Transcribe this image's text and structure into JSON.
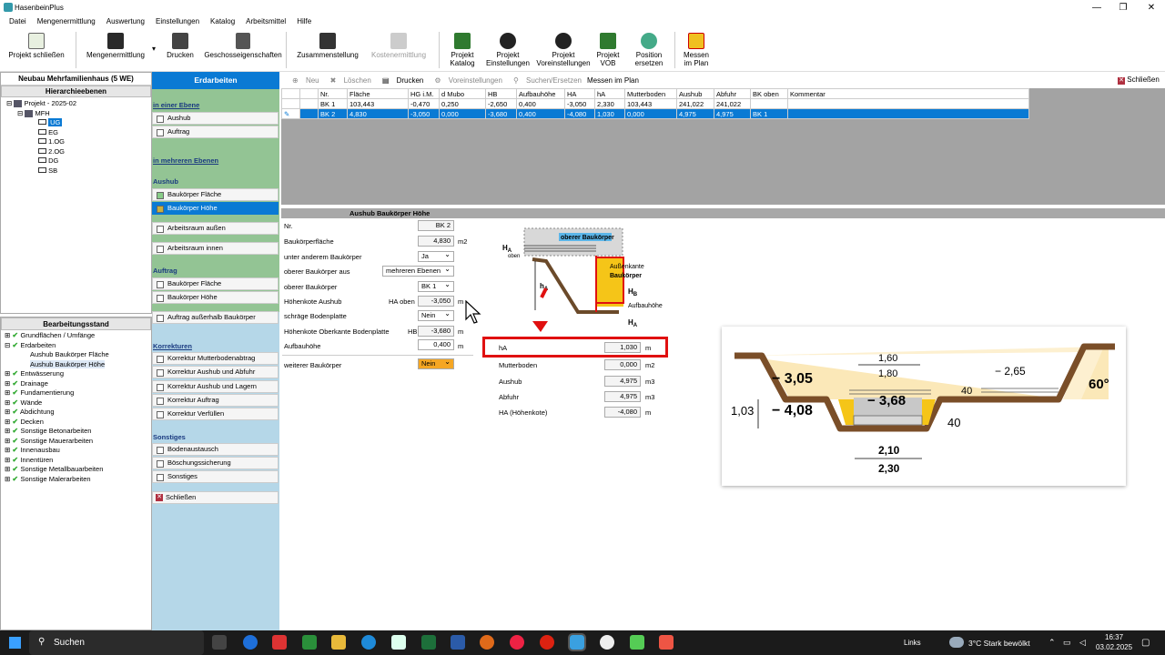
{
  "window": {
    "title": "HasenbeinPlus"
  },
  "menu": [
    "Datei",
    "Mengenermittlung",
    "Auswertung",
    "Einstellungen",
    "Katalog",
    "Arbeitsmittel",
    "Hilfe"
  ],
  "toolbar": {
    "projekt_schliessen": "Projekt schließen",
    "mengenermittlung": "Mengenermittlung",
    "drucken": "Drucken",
    "geschosseigenschaften": "Geschosseigenschaften",
    "zusammenstellung": "Zusammenstellung",
    "kostenermittlung": "Kostenermittlung",
    "projekt_katalog_1": "Projekt",
    "projekt_katalog_2": "Katalog",
    "projekt_einst_1": "Projekt",
    "projekt_einst_2": "Einstellungen",
    "projekt_vor_1": "Projekt",
    "projekt_vor_2": "Voreinstellungen",
    "projekt_vob_1": "Projekt",
    "projekt_vob_2": "VOB",
    "position_1": "Position",
    "position_2": "ersetzen",
    "messen_1": "Messen",
    "messen_2": "im Plan"
  },
  "left": {
    "project_title": "Neubau Mehrfamilienhaus (5 WE)",
    "hierarchy_header": "Hierarchieebenen",
    "tree": [
      {
        "label": "Projekt - 2025-02",
        "level": 0
      },
      {
        "label": "MFH",
        "level": 1
      },
      {
        "label": "UG",
        "level": 2,
        "selected": true
      },
      {
        "label": "EG",
        "level": 2
      },
      {
        "label": "1.OG",
        "level": 2
      },
      {
        "label": "2.OG",
        "level": 2
      },
      {
        "label": "DG",
        "level": 2
      },
      {
        "label": "SB",
        "level": 2
      }
    ],
    "status_header": "Bearbeitungsstand",
    "status": [
      {
        "label": "Grundflächen / Umfänge",
        "level": 0
      },
      {
        "label": "Erdarbeiten",
        "level": 0
      },
      {
        "label": "Aushub Baukörper Fläche",
        "level": 1
      },
      {
        "label": "Aushub Baukörper Höhe",
        "level": 1,
        "selected": true
      },
      {
        "label": "Entwässerung",
        "level": 0
      },
      {
        "label": "Drainage",
        "level": 0
      },
      {
        "label": "Fundamentierung",
        "level": 0
      },
      {
        "label": "Wände",
        "level": 0
      },
      {
        "label": "Abdichtung",
        "level": 0
      },
      {
        "label": "Decken",
        "level": 0
      },
      {
        "label": "Sonstige Betonarbeiten",
        "level": 0
      },
      {
        "label": "Sonstige Mauerarbeiten",
        "level": 0
      },
      {
        "label": "Innenausbau",
        "level": 0
      },
      {
        "label": "Innentüren",
        "level": 0
      },
      {
        "label": "Sonstige Metallbauarbeiten",
        "level": 0
      },
      {
        "label": "Sonstige Malerarbeiten",
        "level": 0
      }
    ]
  },
  "mid": {
    "header": "Erdarbeiten",
    "sec_einer": "in einer Ebene",
    "aushub": "Aushub",
    "auftrag": "Auftrag",
    "sec_mehreren": "in mehreren Ebenen",
    "sec_aushub": "Aushub",
    "bk_flaeche": "Baukörper Fläche",
    "bk_hoehe": "Baukörper Höhe",
    "arb_aussen": "Arbeitsraum außen",
    "arb_innen": "Arbeitsraum innen",
    "sec_auftrag": "Auftrag",
    "auf_flaeche": "Baukörper Fläche",
    "auf_hoehe": "Baukörper Höhe",
    "auf_ausserhalb": "Auftrag außerhalb Baukörper",
    "sec_korr": "Korrekturen",
    "k1": "Korrektur Mutterbodenabtrag",
    "k2": "Korrektur Aushub und Abfuhr",
    "k3": "Korrektur Aushub und Lagern",
    "k4": "Korrektur Auftrag",
    "k5": "Korrektur Verfüllen",
    "sec_sonst": "Sonstiges",
    "s1": "Bodenaustausch",
    "s2": "Böschungssicherung",
    "s3": "Sonstiges",
    "close": "Schließen"
  },
  "subtoolbar": {
    "neu": "Neu",
    "loeschen": "Löschen",
    "drucken": "Drucken",
    "vor": "Voreinstellungen",
    "suchen": "Suchen/Ersetzen",
    "messen": "Messen im Plan",
    "close": "Schließen"
  },
  "grid": {
    "headers": [
      "Nr.",
      "Fläche",
      "HG i.M.",
      "d Mubo",
      "HB",
      "Aufbauhöhe",
      "HA",
      "hA",
      "Mutterboden",
      "Aushub",
      "Abfuhr",
      "BK oben",
      "Kommentar"
    ],
    "rows": [
      [
        "BK 1",
        "103,443",
        "-0,470",
        "0,250",
        "-2,650",
        "0,400",
        "-3,050",
        "2,330",
        "103,443",
        "241,022",
        "241,022",
        "",
        ""
      ],
      [
        "BK 2",
        "4,830",
        "-3,050",
        "0,000",
        "-3,680",
        "0,400",
        "-4,080",
        "1,030",
        "0,000",
        "4,975",
        "4,975",
        "BK 1",
        ""
      ]
    ]
  },
  "form": {
    "title": "Aushub Baukörper Höhe",
    "nr_label": "Nr.",
    "nr": "BK 2",
    "flaeche_label": "Baukörperfläche",
    "flaeche": "4,830",
    "flaeche_unit": "m2",
    "unter_label": "unter anderem Baukörper",
    "unter": "Ja",
    "oberer_aus_label": "oberer Baukörper aus",
    "oberer_aus": "mehreren Ebenen",
    "oberer_label": "oberer Baukörper",
    "oberer": "BK 1",
    "hoehe_label": "Höhenkote Aushub",
    "hoehe_tag": "HA oben",
    "hoehe": "-3,050",
    "hoehe_unit": "m",
    "schraeg_label": "schräge Bodenplatte",
    "schraeg": "Nein",
    "ok_label": "Höhenkote Oberkante Bodenplatte",
    "ok_tag": "HB",
    "ok": "-3,680",
    "ok_unit": "m",
    "aufbau_label": "Aufbauhöhe",
    "aufbau": "0,400",
    "aufbau_unit": "m",
    "weiterer_label": "weiterer Baukörper",
    "weiterer": "Nein"
  },
  "results": [
    {
      "label": "hA",
      "value": "1,030",
      "unit": "m"
    },
    {
      "label": "Mutterboden",
      "value": "0,000",
      "unit": "m2"
    },
    {
      "label": "Aushub",
      "value": "4,975",
      "unit": "m3"
    },
    {
      "label": "Abfuhr",
      "value": "4,975",
      "unit": "m3"
    },
    {
      "label": "HA (Höhenkote)",
      "value": "-4,080",
      "unit": "m"
    }
  ],
  "diagram": {
    "oberer": "oberer Baukörper",
    "ha": "H",
    "ha_sub": "A",
    "oben": "oben",
    "ha2": "h",
    "aussen1": "Außenkante",
    "aussen2": "Baukörper",
    "hb": "H",
    "hb_sub": "B",
    "aufbau": "Aufbauhöhe",
    "hA3": "H",
    "hA3_sub": "A"
  },
  "section": {
    "v305": "− 3,05",
    "v408": "− 4,08",
    "v103": "1,03",
    "v160": "1,60",
    "v180": "1,80",
    "v368": "− 3,68",
    "v265": "− 2,65",
    "v40a": "40",
    "v40b": "40",
    "v60": "60°",
    "v210": "2,10",
    "v230": "2,30"
  },
  "taskbar": {
    "search": "Suchen",
    "links": "Links",
    "weather": "3°C  Stark bewölkt",
    "time": "16:37",
    "date": "03.02.2025"
  },
  "colors": {
    "accent": "#0a7ad4",
    "section_green": "#93c494",
    "mid_bg": "#b5d7e8",
    "highlight": "#e01010"
  }
}
